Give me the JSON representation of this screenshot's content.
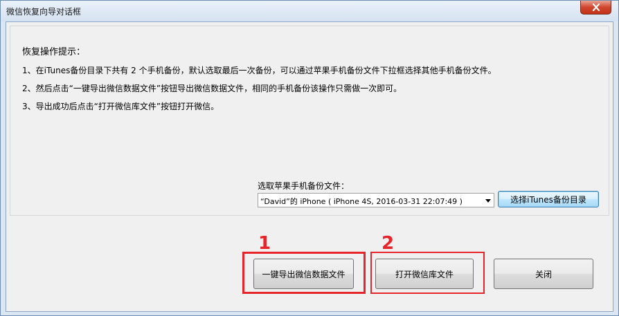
{
  "window": {
    "title": "微信恢复向导对话框"
  },
  "tips": {
    "title": "恢复操作提示：",
    "line1": "1、在iTunes备份目录下共有 2 个手机备份，默认选取最后一次备份，可以通过苹果手机备份文件下拉框选择其他手机备份文件。",
    "line2": "2、然后点击“一键导出微信数据文件”按钮导出微信数据文件，相同的手机备份该操作只需做一次即可。",
    "line3": "3、导出成功后点击“打开微信库文件”按钮打开微信。"
  },
  "backup": {
    "label": "选取苹果手机备份文件：",
    "selected": "“David”的 iPhone ( iPhone 4S, 2016-03-31 22:07:49 )",
    "browse_label": "选择iTunes备份目录"
  },
  "buttons": {
    "export_label": "一键导出微信数据文件",
    "open_label": "打开微信库文件",
    "close_label": "关闭"
  },
  "annotations": {
    "marker1": "1",
    "marker2": "2",
    "color": "#e8242b"
  },
  "icons": {
    "close": "close-x-icon",
    "dropdown": "chevron-down-icon"
  }
}
